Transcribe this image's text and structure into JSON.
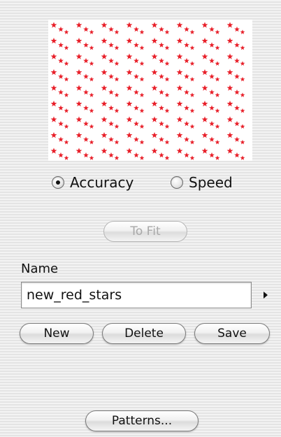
{
  "preview": {
    "pattern": "red-stars",
    "color": "#e8202a"
  },
  "render_mode": {
    "options": [
      "Accuracy",
      "Speed"
    ],
    "selected": "Accuracy"
  },
  "buttons": {
    "to_fit": "To Fit",
    "new": "New",
    "delete": "Delete",
    "save": "Save",
    "patterns": "Patterns..."
  },
  "name": {
    "label": "Name",
    "value": "new_red_stars"
  },
  "icons": {
    "name_menu": "disclosure-arrow-icon"
  }
}
